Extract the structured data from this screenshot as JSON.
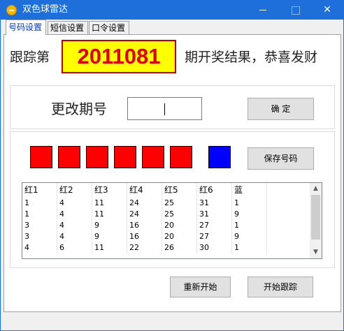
{
  "window": {
    "title": "双色球雷达",
    "title_icon": "app-circle-icon"
  },
  "tabs": [
    {
      "label": "号码设置",
      "active": true
    },
    {
      "label": "短信设置",
      "active": false
    },
    {
      "label": "口令设置",
      "active": false
    }
  ],
  "header": {
    "prefix": "跟踪第",
    "issue_number": "2011081",
    "suffix": "期开奖结果，恭喜发财"
  },
  "change_issue": {
    "label": "更改期号",
    "input_value": "",
    "confirm_label": "确 定"
  },
  "balls": {
    "colors": {
      "red": "#ff0000",
      "blue": "#0000ff"
    },
    "save_label": "保存号码"
  },
  "table": {
    "columns": [
      "红1",
      "红2",
      "红3",
      "红4",
      "红5",
      "红6",
      "蓝"
    ],
    "rows": [
      [
        "1",
        "4",
        "11",
        "24",
        "25",
        "31",
        "1"
      ],
      [
        "1",
        "4",
        "11",
        "24",
        "25",
        "31",
        "9"
      ],
      [
        "3",
        "4",
        "9",
        "16",
        "20",
        "27",
        "1"
      ],
      [
        "3",
        "4",
        "9",
        "16",
        "20",
        "27",
        "9"
      ],
      [
        "4",
        "6",
        "11",
        "22",
        "26",
        "30",
        "1"
      ]
    ]
  },
  "actions": {
    "restart_label": "重新开始",
    "start_label": "开始跟踪"
  }
}
